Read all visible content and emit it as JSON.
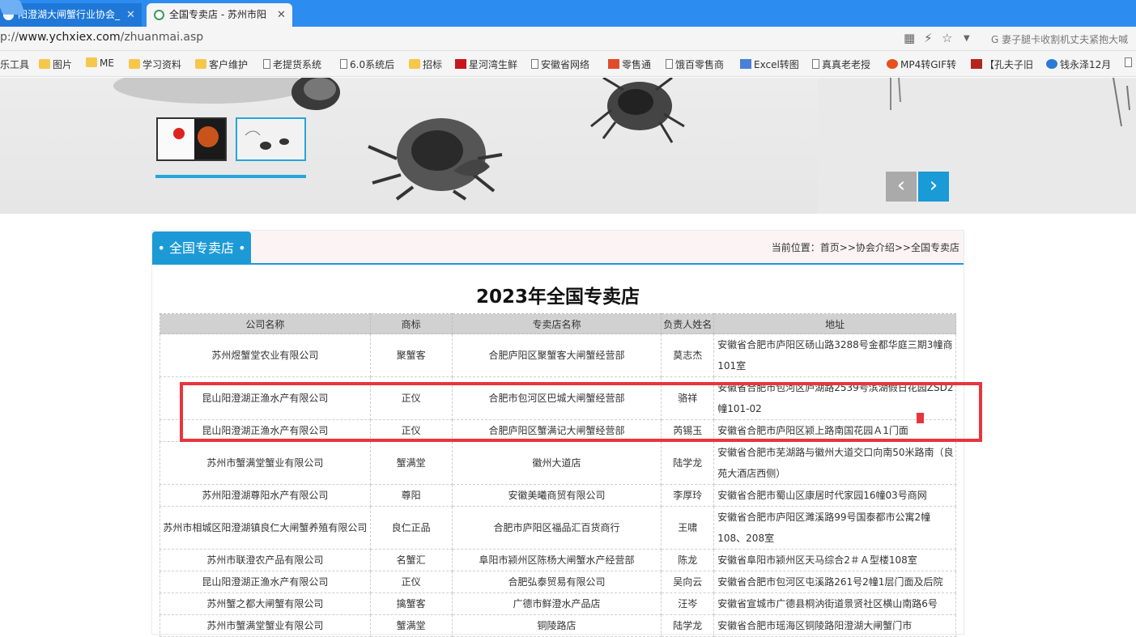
{
  "browser": {
    "tabs": [
      {
        "title": "阳澄湖大闸蟹行业协会_"
      },
      {
        "title": "全国专卖店 - 苏州市阳"
      }
    ],
    "tab_close": "✕",
    "url_prefix": "p://",
    "url_host": "www.ychxiex.com",
    "url_path": "/zhuanmai.asp",
    "search_hint": "G  妻子腿卡收割机丈夫紧抱大喊",
    "bookmarks": [
      "乐工具",
      "图片",
      "ME",
      "学习资料",
      "客户维护",
      "老提货系统",
      "6.0系统后",
      "招标",
      "星河湾生鲜",
      "安徽省网络",
      "零售通",
      "饿百零售商",
      "Excel转图",
      "真真老老授",
      "MP4转GIF转",
      "【孔夫子旧",
      "钱永泽12月"
    ]
  },
  "banner": {
    "prev": "‹",
    "next": "›"
  },
  "section": {
    "tab_label": "全国专卖店",
    "breadcrumb": "当前位置：首页>>协会介绍>>全国专卖店"
  },
  "page_title": "2023年全国专卖店",
  "table": {
    "headers": [
      "公司名称",
      "商标",
      "专卖店名称",
      "负责人姓名",
      "地址"
    ],
    "rows": [
      [
        "苏州煜蟹堂农业有限公司",
        "聚蟹客",
        "合肥庐阳区聚蟹客大闸蟹经营部",
        "莫志杰",
        "安徽省合肥市庐阳区砀山路3288号金都华庭三期3幢商101室"
      ],
      [
        "昆山阳澄湖正渔水产有限公司",
        "正仪",
        "合肥市包河区巴城大闸蟹经营部",
        "骆祥",
        "安徽省合肥市包河区庐湖路2539号滨湖假日花园ZSD2幢101-02"
      ],
      [
        "昆山阳澄湖正渔水产有限公司",
        "正仪",
        "合肥庐阳区蟹满记大闸蟹经营部",
        "芮锡玉",
        "安徽省合肥市庐阳区颍上路南国花园Ａ1门面"
      ],
      [
        "苏州市蟹满堂蟹业有限公司",
        "蟹满堂",
        "徽州大道店",
        "陆学龙",
        "安徽省合肥市芜湖路与徽州大道交口向南50米路南（良苑大酒店西侧）"
      ],
      [
        "苏州阳澄湖尊阳水产有限公司",
        "尊阳",
        "安徽美曦商贸有限公司",
        "李厚玲",
        "安徽省合肥市蜀山区康居时代家园16幢03号商网"
      ],
      [
        "苏州市相城区阳澄湖镇良仁大闸蟹养殖有限公司",
        "良仁正品",
        "合肥市庐阳区福品汇百货商行",
        "王啸",
        "安徽省合肥市庐阳区濉溪路99号国泰都市公寓2幢108、208室"
      ],
      [
        "苏州市联澄农产品有限公司",
        "名蟹汇",
        "阜阳市颍州区陈杨大闸蟹水产经营部",
        "陈龙",
        "安徽省阜阳市颍州区天马综合2＃Ａ型楼108室"
      ],
      [
        "昆山阳澄湖正渔水产有限公司",
        "正仪",
        "合肥弘泰贸易有限公司",
        "吴向云",
        "安徽省合肥市包河区屯溪路261号2幢1层门面及后院"
      ],
      [
        "苏州蟹之都大闸蟹有限公司",
        "擒蟹客",
        "广德市鲜澄水产品店",
        "汪岑",
        "安徽省宣城市广德县桐汭街道景贤社区横山南路6号"
      ],
      [
        "苏州市蟹满堂蟹业有限公司",
        "蟹满堂",
        "铜陵路店",
        "陆学龙",
        "安徽省合肥市瑶海区铜陵路阳澄湖大闸蟹门市"
      ]
    ]
  }
}
